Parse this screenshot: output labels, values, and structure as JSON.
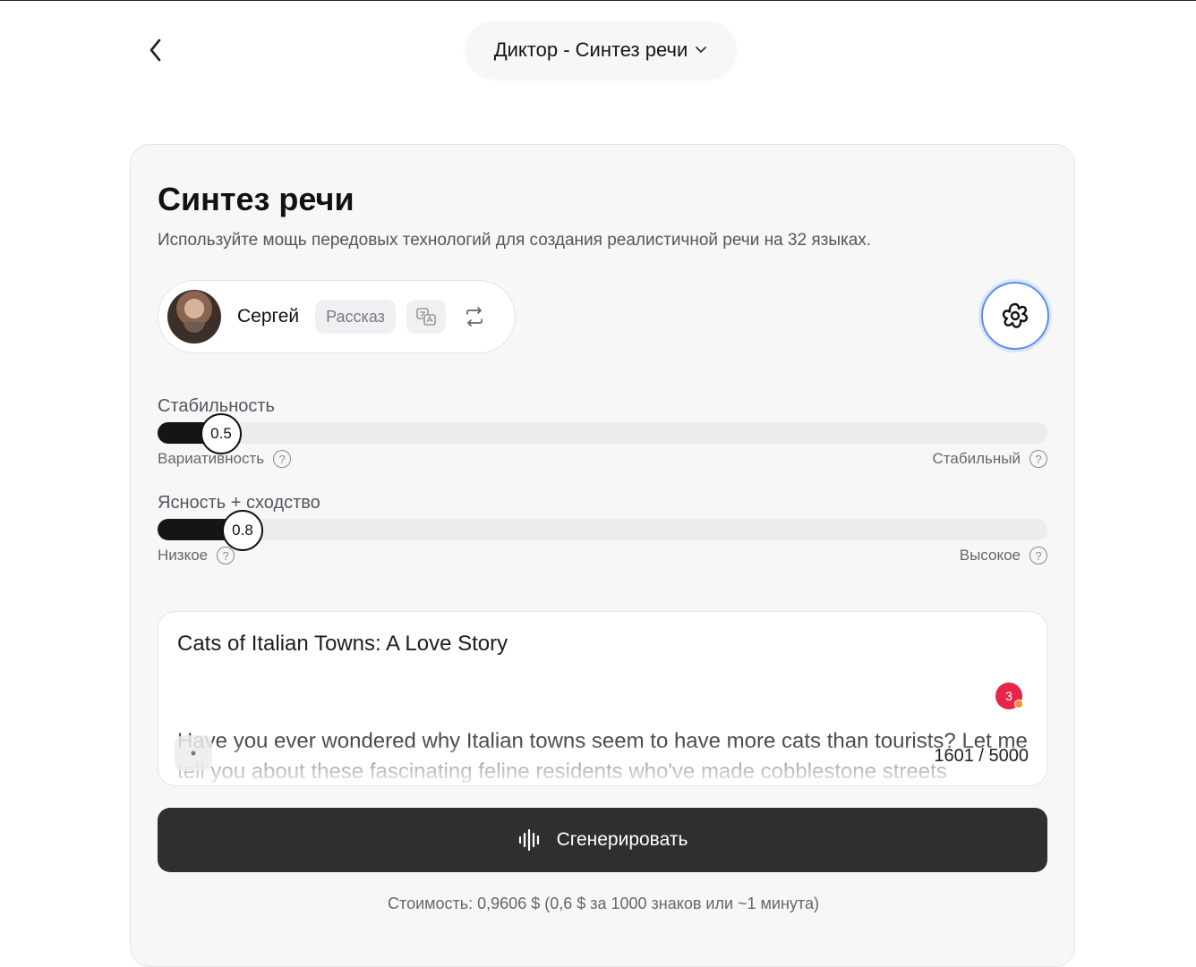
{
  "header": {
    "title": "Диктор - Синтез речи"
  },
  "card": {
    "title": "Синтез речи",
    "subtitle": "Используйте мощь передовых технологий для создания реалистичной речи на 32 языках."
  },
  "voice": {
    "name": "Сергей",
    "tag": "Рассказ"
  },
  "sliders": {
    "stability": {
      "label": "Стабильность",
      "value": 0.5,
      "value_text": "0.5",
      "left_text": "Вариативность",
      "right_text": "Стабильный"
    },
    "clarity": {
      "label": "Ясность + сходство",
      "value": 0.8,
      "value_text": "0.8",
      "left_text": "Низкое",
      "right_text": "Высокое"
    }
  },
  "editor": {
    "title": "Cats of Italian Towns: A Love Story",
    "body": "Have you ever wondered why Italian towns seem to have more cats than tourists? Let me tell you about these fascinating feline residents who've made cobblestone streets",
    "counter": "1601 / 5000",
    "badge": "3"
  },
  "generate": {
    "label": "Сгенерировать"
  },
  "cost": "Стоимость: 0,9606 $ (0,6 $ за 1000 знаков или ~1 минута)",
  "colors": {
    "accent": "#5b8def",
    "button": "#2f2f30",
    "badge": "#e5264a",
    "badge_dot": "#ff8a2a"
  },
  "icons": {
    "back": "chevron-left-icon",
    "dropdown": "chevron-down-icon",
    "translate": "translate-icon",
    "swap": "swap-icon",
    "settings": "settings-flower-icon",
    "help": "question-icon",
    "waveform": "waveform-icon"
  }
}
